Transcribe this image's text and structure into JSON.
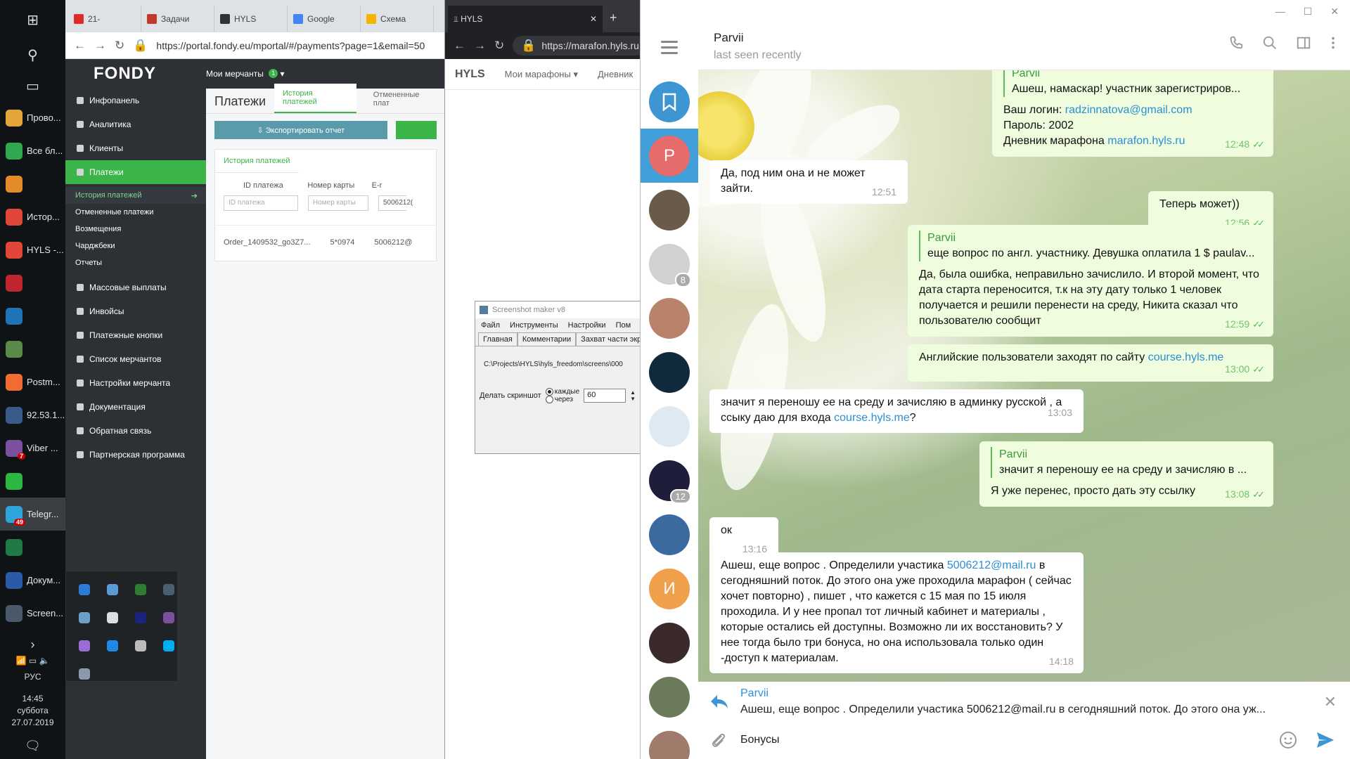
{
  "taskbar": {
    "items": [
      {
        "label": "Прово...",
        "color": "#e4a63a"
      },
      {
        "label": "Все бл...",
        "color": "#2fa84f"
      },
      {
        "label": "",
        "color": "#e38b2a"
      },
      {
        "label": "Истор...",
        "color": "#e0463a"
      },
      {
        "label": "HYLS -...",
        "color": "#e0463a"
      },
      {
        "label": "",
        "color": "#c0262d"
      },
      {
        "label": "",
        "color": "#1f74b8"
      },
      {
        "label": "",
        "color": "#5a8a4a"
      },
      {
        "label": "Postm...",
        "color": "#ef6c35"
      },
      {
        "label": "92.53.1...",
        "color": "#3a5a8a"
      },
      {
        "label": "Viber ...",
        "color": "#7b519d",
        "badge": "7"
      },
      {
        "label": "",
        "color": "#2bb741"
      },
      {
        "label": "Telegr...",
        "color": "#2fa3da",
        "badge": "49"
      },
      {
        "label": "",
        "color": "#1f7a45"
      },
      {
        "label": "Докум...",
        "color": "#2a5aa8"
      },
      {
        "label": "Screen...",
        "color": "#4a5a6a"
      }
    ],
    "lang": "РУС",
    "time": "14:45",
    "weekday": "суббота",
    "date": "27.07.2019"
  },
  "chrome1": {
    "tabs": [
      "21-",
      "Задачи",
      "HYLS",
      "Google",
      "Схема"
    ],
    "url": "https://portal.fondy.eu/mportal/#/payments?page=1&email=50"
  },
  "fondy": {
    "logo": "FONDY",
    "merchants_label": "Мои мерчанты",
    "merchants_badge": "1",
    "sidebar": [
      "Инфопанель",
      "Аналитика",
      "Клиенты",
      "Платежи"
    ],
    "sidebar_sub": [
      "История платежей",
      "Отмененные платежи",
      "Возмещения",
      "Чарджбеки",
      "Отчеты"
    ],
    "sidebar_more": [
      "Массовые выплаты",
      "Инвойсы",
      "Платежные кнопки",
      "Список мерчантов",
      "Настройки мерчанта",
      "Документация",
      "Обратная связь",
      "Партнерская программа"
    ],
    "page_title": "Платежи",
    "tabs": [
      "История платежей",
      "Отмененные плат"
    ],
    "export_btn": "⇩ Экспортировать отчет",
    "panel_tab": "История платежей",
    "columns": [
      "ID платежа",
      "Номер карты",
      "E-r"
    ],
    "filters": [
      "ID платежа",
      "Номер карты",
      "5006212("
    ],
    "row": [
      "Order_1409532_go3Z7...",
      "5*0974",
      "5006212@"
    ]
  },
  "chrome2": {
    "tab": "HYLS",
    "url": "https://marafon.hyls.ru",
    "logo": "HYLS",
    "nav": [
      "Мои марафоны ▾",
      "Дневник"
    ]
  },
  "smaker": {
    "title": "Screenshot maker v8",
    "menu": [
      "Файл",
      "Инструменты",
      "Настройки",
      "Пом"
    ],
    "tabs": [
      "Главная",
      "Комментарии",
      "Захват части экра"
    ],
    "path": "C:\\Projects\\HYLS\\hyls_freedom\\screens\\000",
    "shot_label": "Делать скриншот",
    "opt_every": "каждые",
    "opt_after": "через",
    "interval": "60"
  },
  "telegram": {
    "contact": "Parvii",
    "status": "last seen recently",
    "rail": [
      {
        "kind": "saved",
        "color": "#3d95d4"
      },
      {
        "letter": "P",
        "color": "#e66b6b",
        "selected": true
      },
      {
        "color": "#6a5a4a"
      },
      {
        "color": "#cfd1d3",
        "badge": "8"
      },
      {
        "color": "#b8836a"
      },
      {
        "color": "#0f2a3a"
      },
      {
        "color": "#dfe9f1"
      },
      {
        "color": "#1e1e3a",
        "badge": "12"
      },
      {
        "color": "#3a6aa0"
      },
      {
        "letter": "И",
        "color": "#f0a04a"
      },
      {
        "color": "#3a2a2a"
      },
      {
        "color": "#6a7a5a"
      },
      {
        "color": "#a07a6a"
      }
    ],
    "messages": {
      "m1": {
        "quote_name": "Parvii",
        "quote_text": "Ашеш, намаскар! участник зарегистриров...",
        "l1": "Ваш логин: ",
        "l1_link": "radzinnatova@gmail.com",
        "l2": "Пароль: 2002",
        "l3": "Дневник марафона ",
        "l3_link": "marafon.hyls.ru",
        "time": "12:48"
      },
      "m2": {
        "text": "Да, под ним она и не может зайти.",
        "time": "12:51"
      },
      "m3": {
        "text": "Теперь может))",
        "time": "12:56"
      },
      "m4": {
        "quote_name": "Parvii",
        "quote_text": "еще вопрос по англ. участнику.  Девушка оплатила 1 $ paulav...",
        "text": "Да, была ошибка, неправильно зачислило. И второй момент, что дата старта переносится, т.к на эту дату только 1 человек получается и решили перенести на среду, Никита сказал что пользователю сообщит",
        "time": "12:59"
      },
      "m5": {
        "text": "Английские пользователи заходят по сайту ",
        "link": "course.hyls.me",
        "time": "13:00"
      },
      "m6": {
        "text": "значит я переношу ее на среду и зачисляю в админку русской , а ссыку даю для входа  ",
        "link": "course.hyls.me",
        "tail": "?",
        "time": "13:03"
      },
      "m7": {
        "quote_name": "Parvii",
        "quote_text": "значит я переношу ее на среду и зачисляю в ...",
        "text": "Я уже перенес, просто дать эту ссылку",
        "time": "13:08"
      },
      "m8": {
        "text": "ок",
        "time": "13:16"
      },
      "m9": {
        "pre": "Ашеш, еще вопрос . Определили участика ",
        "link": "5006212@mail.ru",
        "post": " в сегодняшний поток. До этого она уже проходила марафон ( сейчас хочет повторно) , пишет , что кажется с 15 мая по 15 июля проходила. И у нее пропал тот личный кабинет и материалы , которые остались ей доступны. Возможно ли их восстановить? У нее тогда было три бонуса, но она использовала только один -доступ к материалам.",
        "time": "14:18"
      }
    },
    "reply_name": "Parvii",
    "reply_text": "Ашеш, еще вопрос . Определили участика 5006212@mail.ru в сегодняшний поток. До этого она уж...",
    "input_value": "Бонусы"
  }
}
